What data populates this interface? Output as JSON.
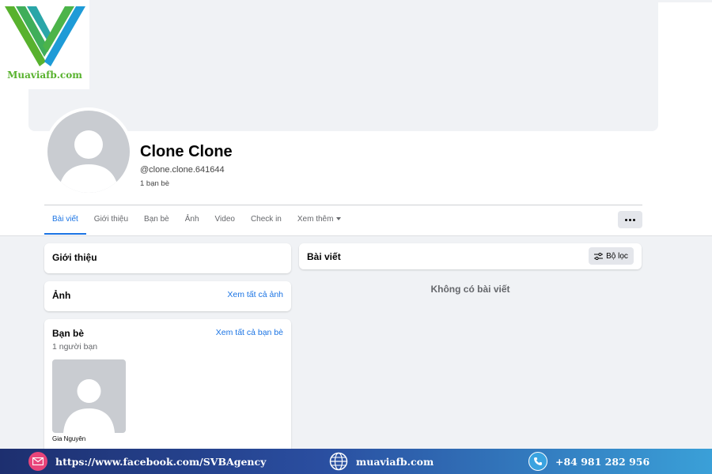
{
  "brand": {
    "logo_text": "Muaviafb.com"
  },
  "profile": {
    "name": "Clone Clone",
    "handle": "@clone.clone.641644",
    "friends_count": "1 bạn bè"
  },
  "tabs": [
    {
      "label": "Bài viết",
      "active": true
    },
    {
      "label": "Giới thiệu"
    },
    {
      "label": "Bạn bè"
    },
    {
      "label": "Ảnh"
    },
    {
      "label": "Video"
    },
    {
      "label": "Check in"
    },
    {
      "label": "Xem thêm"
    }
  ],
  "intro": {
    "title": "Giới thiệu"
  },
  "photos": {
    "title": "Ảnh",
    "link": "Xem tất cả ảnh"
  },
  "friends": {
    "title": "Bạn bè",
    "subtitle": "1 người bạn",
    "link": "Xem tất cả bạn bè",
    "items": [
      {
        "name": "Gia Nguyên"
      }
    ]
  },
  "posts": {
    "title": "Bài viết",
    "filter_label": "Bộ lọc",
    "empty_text": "Không có bài viết"
  },
  "footer": {
    "facebook_url": "https://www.facebook.com/SVBAgency",
    "website": "muaviafb.com",
    "phone": "+84 981 282 956"
  },
  "colors": {
    "accent": "#1b74e4",
    "page_bg": "#f0f2f5",
    "logo_green": "#58b22e",
    "logo_blue": "#1e9bd7"
  },
  "icons": [
    "logo-v-icon",
    "more-dots-icon",
    "filter-icon",
    "mail-icon",
    "globe-icon",
    "phone-icon",
    "default-avatar-icon"
  ]
}
